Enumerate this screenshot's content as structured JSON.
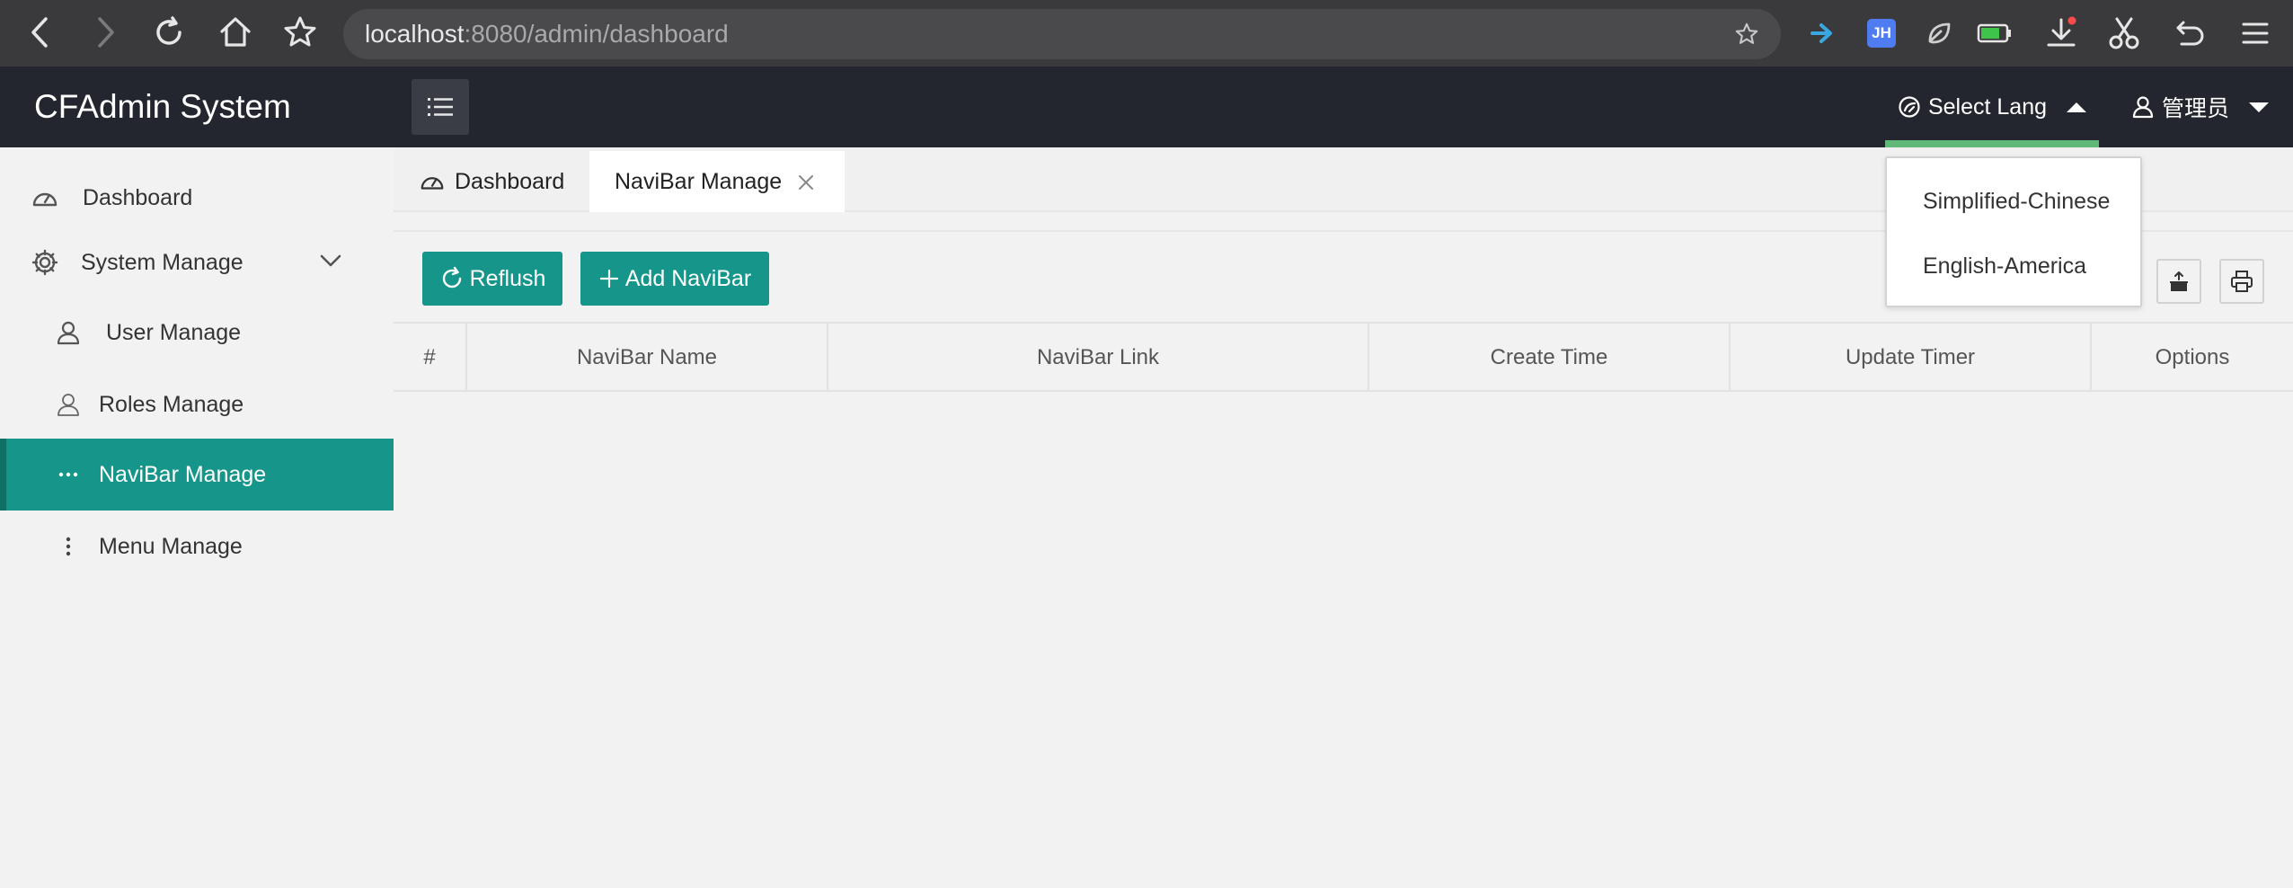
{
  "browser": {
    "url_host": "localhost",
    "url_path": ":8080/admin/dashboard",
    "extensions": [
      "arrow-extension-icon",
      "jh-extension-icon",
      "leaf-extension-icon",
      "battery-icon",
      "download-icon",
      "scissors-icon",
      "undo-icon",
      "menu-icon"
    ],
    "jh_label": "JH"
  },
  "header": {
    "title": "CFAdmin System",
    "lang_label": "Select Lang",
    "user_label": "管理员"
  },
  "sidebar": {
    "items": [
      {
        "label": "Dashboard",
        "icon": "dashboard-icon"
      },
      {
        "label": "System Manage",
        "icon": "gear-icon"
      },
      {
        "label": "User Manage",
        "icon": "user-icon"
      },
      {
        "label": "Roles Manage",
        "icon": "user-outline-icon"
      },
      {
        "label": "NaviBar Manage",
        "icon": "more-horizontal-icon",
        "active": true
      },
      {
        "label": "Menu Manage",
        "icon": "more-vertical-icon"
      }
    ]
  },
  "tabs": [
    {
      "label": "Dashboard"
    },
    {
      "label": "NaviBar Manage",
      "active": true
    }
  ],
  "toolbar": {
    "refresh_label": "Reflush",
    "add_label": "Add NaviBar"
  },
  "table": {
    "columns": [
      "#",
      "NaviBar Name",
      "NaviBar Link",
      "Create Time",
      "Update Timer",
      "Options"
    ]
  },
  "lang_dropdown": {
    "options": [
      "Simplified-Chinese",
      "English-America"
    ]
  },
  "colors": {
    "accent": "#16968a",
    "header_bg": "#23262e",
    "lang_underline": "#5fb878",
    "browser_bg": "#3a3a3c"
  }
}
